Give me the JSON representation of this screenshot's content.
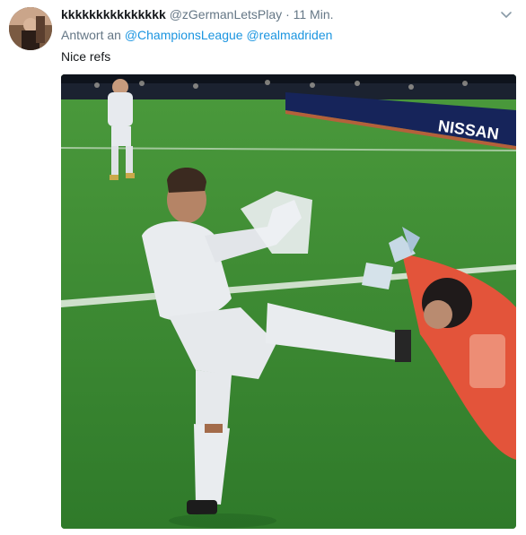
{
  "tweet": {
    "display_name": "kkkkkkkkkkkkkkk",
    "handle": "@zGermanLetsPlay",
    "separator": "·",
    "time": "11 Min.",
    "reply_prefix": "Antwort an",
    "reply_to_1": "@ChampionsLeague",
    "reply_to_2": "@realmadriden",
    "text": "Nice refs",
    "media": {
      "board_text": "NISSAN",
      "colors": {
        "pitch": "#3f8a34",
        "kit_white": "#e9ecef",
        "keeper_orange": "#e3543a",
        "board_blue": "#16245a"
      }
    }
  },
  "icons": {
    "caret": "chevron-down-icon"
  }
}
